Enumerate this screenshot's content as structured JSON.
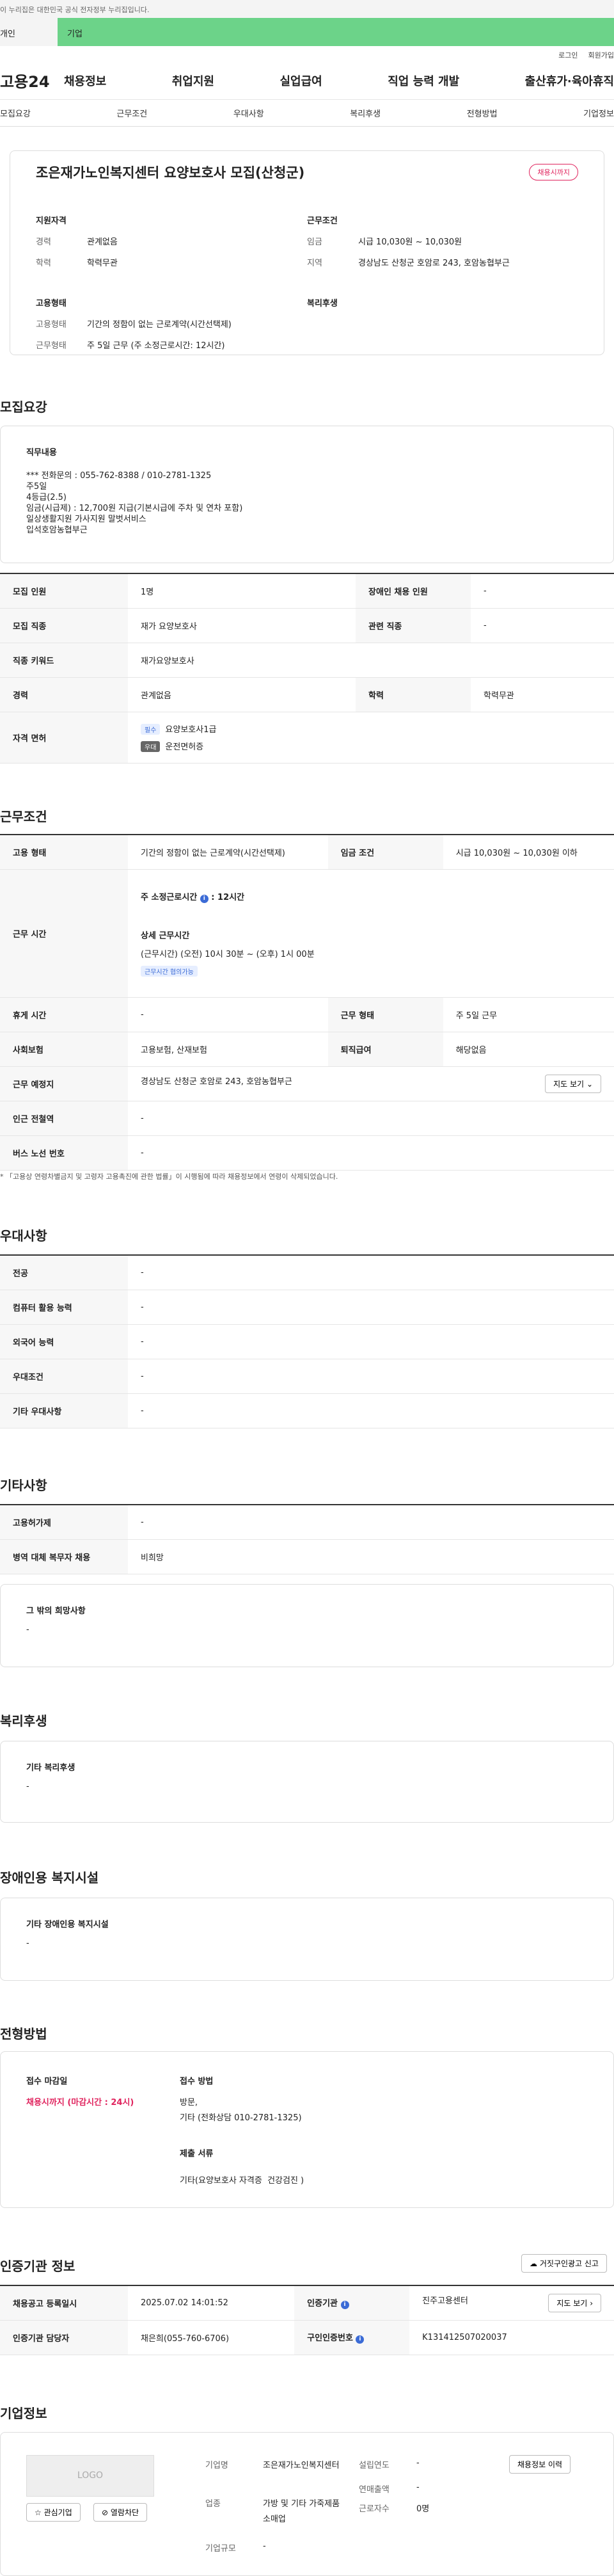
{
  "top_notice": "이 누리집은 대한민국 공식 전자정부 누리집입니다.",
  "category": {
    "personal": "개인",
    "company": "기업"
  },
  "util": {
    "login": "로그인",
    "join": "회원가입"
  },
  "gnb": {
    "logo": "고용24",
    "menu": [
      "채용정보",
      "취업지원",
      "실업급여",
      "직업 능력 개발",
      "출산휴가·육아휴직"
    ]
  },
  "tabs": [
    "모집요강",
    "근무조건",
    "우대사항",
    "복리후생",
    "전형방법",
    "기업정보"
  ],
  "summary": {
    "title": "조은재가노인복지센터 요양보호사 모집(산청군)",
    "badge": "채용시까지",
    "qual_title": "지원자격",
    "qual": [
      {
        "k": "경력",
        "v": "관계없음"
      },
      {
        "k": "학력",
        "v": "학력무관"
      }
    ],
    "cond_title": "근무조건",
    "cond": [
      {
        "k": "임금",
        "v": "시급 10,030원 ~ 10,030원"
      },
      {
        "k": "지역",
        "v": "경상남도 산청군 호암로 243, 호암농협부근"
      }
    ],
    "form_title": "고용형태",
    "form": [
      {
        "k": "고용형태",
        "v": "기간의 정함이 없는 근로계약(시간선택제)"
      },
      {
        "k": "근무형태",
        "v": "주 5일 근무 (주 소정근로시간: 12시간)"
      }
    ],
    "welfare_title": "복리후생"
  },
  "recruit": {
    "section_title": "모집요강",
    "duty_title": "직무내용",
    "duty_text": "*** 전화문의 : 055-762-8388 / 010-2781-1325\n주5일\n4등급(2.5)\n임금(시급제) : 12,700원 지급(기본시급에 주차 및 연차 포함)\n일상생활지원 가사지원 말벗서비스\n입석호암농협부근",
    "rows": {
      "count_k": "모집 인원",
      "count_v": "1명",
      "disabled_k": "장애인 채용 인원",
      "disabled_v": "-",
      "job_k": "모집 직종",
      "job_v": "재가 요양보호사",
      "related_k": "관련 직종",
      "related_v": "-",
      "keyword_k": "직종 키워드",
      "keyword_v": "재가요양보호사",
      "career_k": "경력",
      "career_v": "관계없음",
      "edu_k": "학력",
      "edu_v": "학력무관",
      "license_k": "자격 면허",
      "license_tag1": "필수",
      "license_v1": "요양보호사1급",
      "license_tag2": "우대",
      "license_v2": "운전면허증"
    }
  },
  "work": {
    "section_title": "근무조건",
    "emp_k": "고용 형태",
    "emp_v": "기간의 정함이 없는 근로계약(시간선택제)",
    "wage_k": "임금 조건",
    "wage_v": "시급 10,030원 ~ 10,030원 이하",
    "hours_k": "근무 시간",
    "hours_week": "주 소정근로시간",
    "hours_week_v": "12시간",
    "hours_detail_title": "상세 근무시간",
    "hours_detail": "(근무시간) (오전) 10시 30분 ~ (오후) 1시 00분",
    "hours_tag": "근무시간 협의가능",
    "rest_k": "휴게 시간",
    "rest_v": "-",
    "type_k": "근무 형태",
    "type_v": "주 5일 근무",
    "ins_k": "사회보험",
    "ins_v": "고용보험, 산재보험",
    "sev_k": "퇴직급여",
    "sev_v": "해당없음",
    "place_k": "근무 예정지",
    "place_v": "경상남도 산청군 호암로 243, 호암농협부근",
    "map_btn": "지도 보기",
    "station_k": "인근 전철역",
    "station_v": "-",
    "bus_k": "버스 노선 번호",
    "bus_v": "-",
    "note": "* 「고용상 연령차별금지 및 고령자 고용촉진에 관한 법률」이 시행됨에 따라 채용정보에서 연령이 삭제되었습니다."
  },
  "pref": {
    "section_title": "우대사항",
    "rows": [
      {
        "k": "전공",
        "v": "-"
      },
      {
        "k": "컴퓨터 활용 능력",
        "v": "-"
      },
      {
        "k": "외국어 능력",
        "v": "-"
      },
      {
        "k": "우대조건",
        "v": "-"
      },
      {
        "k": "기타 우대사항",
        "v": "-"
      }
    ]
  },
  "etc": {
    "section_title": "기타사항",
    "hire_k": "고용허가제",
    "hire_v": "-",
    "army_k": "병역 대체 복무자 채용",
    "army_v": "비희망",
    "wish_title": "그 밖의 희망사항",
    "wish_v": "-"
  },
  "welfare": {
    "section_title": "복리후생",
    "sub_title": "기타 복리후생",
    "v": "-"
  },
  "disabled": {
    "section_title": "장애인용 복지시설",
    "sub_title": "기타 장애인용 복지시설",
    "v": "-"
  },
  "process": {
    "section_title": "전형방법",
    "deadline_title": "접수 마감일",
    "deadline_v": "채용시까지 (마감시간 : 24시)",
    "method_title": "접수 방법",
    "method_v1": "방문,",
    "method_v2": "기타 (전화상담 010-2781-1325)",
    "docs_title": "제출 서류",
    "docs_v": "기타(요양보호사 자격증  건강검진 )"
  },
  "cert": {
    "section_title": "인증기관 정보",
    "report_btn": "거짓구인광고 신고",
    "reg_k": "채용공고 등록일시",
    "reg_v": "2025.07.02 14:01:52",
    "org_k": "인증기관",
    "org_v": "진주고용센터",
    "map_btn": "지도 보기",
    "mgr_k": "인증기관 담당자",
    "mgr_v": "채은희(055-760-6706)",
    "num_k": "구인인증번호",
    "num_v": "K131412507020037"
  },
  "company": {
    "section_title": "기업정보",
    "logo_text": "LOGO",
    "fav_btn": "관심기업",
    "block_btn": "열람차단",
    "info_btn": "채용정보 이력",
    "name_k": "기업명",
    "name_v": "조은재가노인복지센터",
    "founded_k": "설립연도",
    "founded_v": "-",
    "sales_k": "연매출액",
    "sales_v": "-",
    "ind_k": "업종",
    "ind_v": "가방 및 기타 가죽제품 소매업",
    "emp_k": "근로자수",
    "emp_v": "0명",
    "size_k": "기업규모",
    "size_v": "-"
  }
}
